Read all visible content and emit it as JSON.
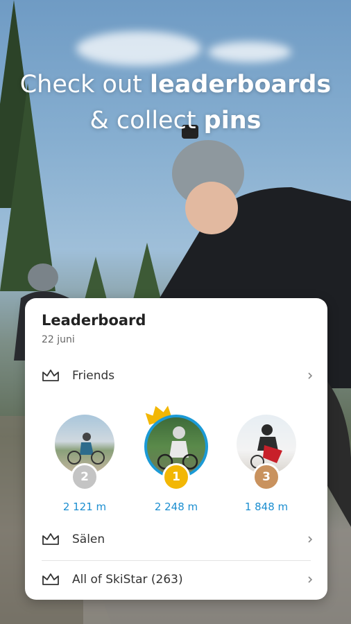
{
  "headline": {
    "line1_prefix": "Check out ",
    "line1_bold": "leaderboards",
    "line2_prefix": "& collect ",
    "line2_bold": "pins"
  },
  "leaderboard": {
    "title": "Leaderboard",
    "date": "22 juni",
    "friends_label": "Friends",
    "podium": [
      {
        "rank": "2",
        "distance": "2 121 m",
        "badge_color": "#c4c4c4"
      },
      {
        "rank": "1",
        "distance": "2 248 m",
        "badge_color": "#f2b705"
      },
      {
        "rank": "3",
        "distance": "1 848 m",
        "badge_color": "#c9925e"
      }
    ],
    "rows": [
      {
        "label": "Sälen"
      },
      {
        "label": "All of SkiStar (263)"
      }
    ]
  },
  "colors": {
    "accent": "#1b8ed0",
    "gold": "#f2b705",
    "silver": "#c4c4c4",
    "bronze": "#c9925e"
  }
}
